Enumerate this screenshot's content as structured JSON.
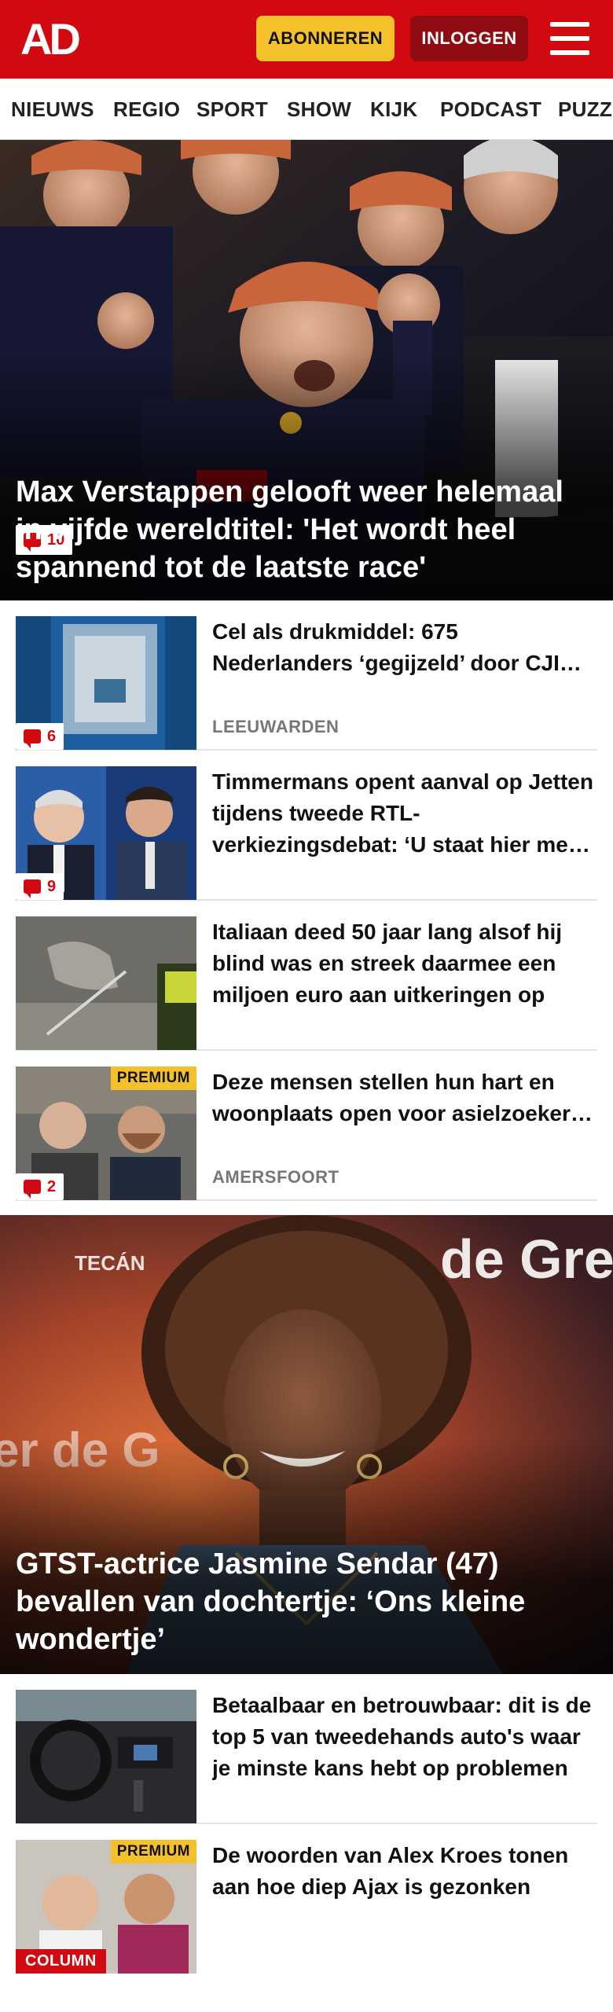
{
  "header": {
    "logo": "AD",
    "subscribe_label": "ABONNEREN",
    "login_label": "INLOGGEN"
  },
  "nav": {
    "items": [
      "NIEUWS",
      "REGIO",
      "SPORT",
      "SHOW",
      "KIJK",
      "PODCAST",
      "PUZZ"
    ]
  },
  "hero": {
    "comments": "10",
    "title": "Max Verstappen gelooft weer helemaal in vijfde wereldtitel: 'Het wordt heel spannend tot de laatste race'"
  },
  "articles": [
    {
      "title": "Cel als drukmiddel: 675 Nederlanders ‘gegijzeld’ door CJIB na weigeren van betalen boete",
      "location": "LEEUWARDEN",
      "comments": "6"
    },
    {
      "title": "Timmermans opent aanval op Jetten tijdens tweede RTL-verkiezingsdebat: ‘U staat hier met lege handen’",
      "comments": "9"
    },
    {
      "title": "Italiaan deed 50 jaar lang alsof hij blind was en streek daarmee een miljoen euro aan uitkeringen op"
    },
    {
      "title": "Deze mensen stellen hun hart en woonplaats open voor asielzoe­kers: ‘Tijd voor een ander geluid’",
      "location": "AMERSFOORT",
      "comments": "2",
      "badge": "PREMIUM"
    }
  ],
  "hero2": {
    "title": "GTST-actrice Jasmine Sendar (47) bevallen van dochtertje: ‘Ons kleine wondertje’",
    "bg_text": "de Grens",
    "bg_text_left": "er de G",
    "bg_sponsor": "TECÁN"
  },
  "articles2": [
    {
      "title": "Betaalbaar en betrouwbaar: dit is de top 5 van tweedehands auto's waar je minste kans hebt op problemen"
    },
    {
      "title": "De woorden van Alex Kroes tonen aan hoe diep Ajax is gezonken",
      "badge": "PREMIUM",
      "tag": "COLUMN"
    }
  ],
  "colors": {
    "brand_red": "#d10a11",
    "login_dark_red": "#8f0c12",
    "premium_yellow": "#f5c12b"
  }
}
